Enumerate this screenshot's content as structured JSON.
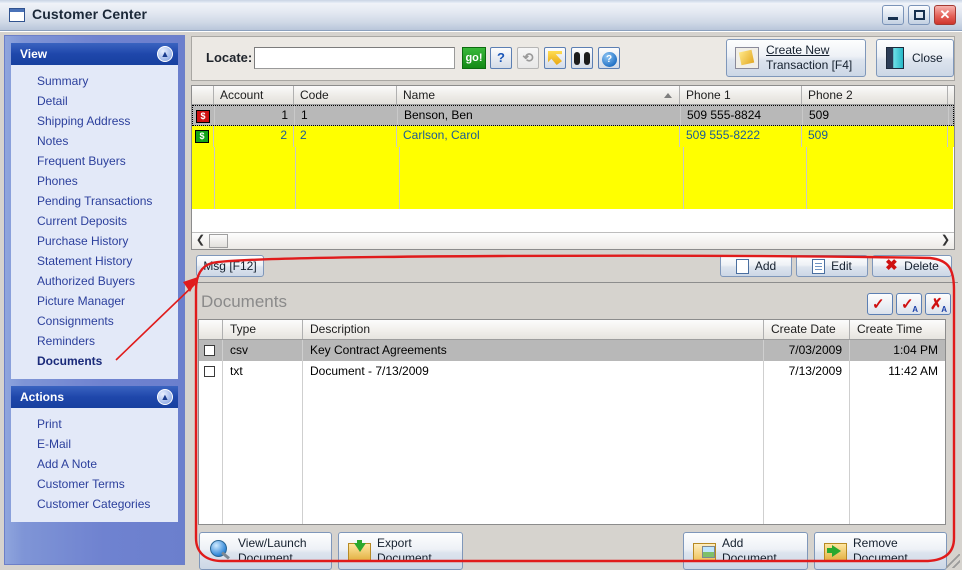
{
  "window": {
    "title": "Customer Center",
    "icon": "window-icon",
    "minimize_label": "_",
    "maximize_label": "□",
    "close_label": "✕"
  },
  "sidebar": {
    "view_group": {
      "title": "View",
      "collapse_icon": "chevron-up-icon",
      "items": [
        {
          "label": "Summary",
          "active": false
        },
        {
          "label": "Detail",
          "active": false
        },
        {
          "label": "Shipping Address",
          "active": false
        },
        {
          "label": "Notes",
          "active": false
        },
        {
          "label": "Frequent Buyers",
          "active": false
        },
        {
          "label": "Phones",
          "active": false
        },
        {
          "label": "Pending Transactions",
          "active": false
        },
        {
          "label": "Current Deposits",
          "active": false
        },
        {
          "label": "Purchase History",
          "active": false
        },
        {
          "label": "Statement History",
          "active": false
        },
        {
          "label": "Authorized Buyers",
          "active": false
        },
        {
          "label": "Picture Manager",
          "active": false
        },
        {
          "label": "Consignments",
          "active": false
        },
        {
          "label": "Reminders",
          "active": false
        },
        {
          "label": "Documents",
          "active": true
        }
      ]
    },
    "actions_group": {
      "title": "Actions",
      "collapse_icon": "chevron-up-icon",
      "items": [
        {
          "label": "Print"
        },
        {
          "label": "E-Mail"
        },
        {
          "label": "Add A Note"
        },
        {
          "label": "Customer Terms"
        },
        {
          "label": "Customer Categories"
        }
      ]
    }
  },
  "toolbar": {
    "locate_label": "Locate:",
    "locate_value": "",
    "locate_placeholder": "",
    "go_label": "go!",
    "help_label": "?",
    "refresh_icon": "refresh-icon",
    "jump_icon": "yellow-arrow-icon",
    "find_icon": "binoculars-icon",
    "info_icon": "info-circle-icon",
    "create_transaction_label_line1": "Create New",
    "create_transaction_label_line2": "Transaction [F4]",
    "create_transaction_icon": "edit-note-icon",
    "close_label": "Close",
    "close_icon": "exit-door-icon"
  },
  "customer_grid": {
    "columns": [
      "",
      "Account",
      "Code",
      "Name",
      "Phone 1",
      "Phone 2"
    ],
    "sorted_column": "Name",
    "sort_direction": "asc",
    "rows": [
      {
        "status_icon": "money-red-icon",
        "account": "1",
        "code": "1",
        "name": "Benson, Ben",
        "phone1": "509  555-8824",
        "phone2": "509",
        "selected": true
      },
      {
        "status_icon": "money-green-icon",
        "account": "2",
        "code": "2",
        "name": "Carlson, Carol",
        "phone1": "509  555-8222",
        "phone2": "509",
        "selected": false
      }
    ],
    "scroll_left_icon": "chevron-left-icon",
    "scroll_right_icon": "chevron-right-icon"
  },
  "grid_actions": {
    "msg_label": "Msg [F12]",
    "add_label": "Add",
    "edit_label": "Edit",
    "delete_label": "Delete",
    "add_icon": "new-document-icon",
    "edit_icon": "edit-document-icon",
    "delete_icon": "red-x-icon"
  },
  "documents_panel": {
    "title": "Documents",
    "header_buttons": [
      {
        "name": "check-all-button",
        "glyph": "✓"
      },
      {
        "name": "check-all-attachments-button",
        "glyph": "✓",
        "sub": "A"
      },
      {
        "name": "uncheck-all-attachments-button",
        "glyph": "✗",
        "sub": "A"
      }
    ],
    "columns": [
      "",
      "Type",
      "Description",
      "Create Date",
      "Create Time"
    ],
    "rows": [
      {
        "checked": false,
        "type": "csv",
        "description": "Key Contract Agreements",
        "create_date": "7/03/2009",
        "create_time": "1:04 PM",
        "selected": true
      },
      {
        "checked": false,
        "type": "txt",
        "description": "Document - 7/13/2009",
        "create_date": "7/13/2009",
        "create_time": "11:42 AM",
        "selected": false
      }
    ],
    "buttons": [
      {
        "name": "view-launch-document-button",
        "line1": "View/Launch",
        "line2": "Document",
        "icon": "magnifier-icon"
      },
      {
        "name": "export-document-button",
        "line1": "Export",
        "line2": "Document",
        "icon": "folder-download-icon"
      },
      {
        "name": "add-document-button",
        "line1": "Add",
        "line2": "Document",
        "icon": "folder-add-icon"
      },
      {
        "name": "remove-document-button",
        "line1": "Remove",
        "line2": "Document",
        "icon": "folder-remove-icon"
      }
    ]
  },
  "annotation": {
    "shape": "red-ellipse-callout",
    "color": "#e01b1b",
    "target": "documents-panel",
    "arrow_points_to": "documents-sidebar-item"
  },
  "colors": {
    "accent_blue": "#17409f",
    "sidebar_blue": "#6f82d0",
    "highlight_yellow": "#ffff00",
    "selection_gray": "#b8b8b8",
    "annotation_red": "#e01b1b",
    "go_green": "#148a16"
  }
}
